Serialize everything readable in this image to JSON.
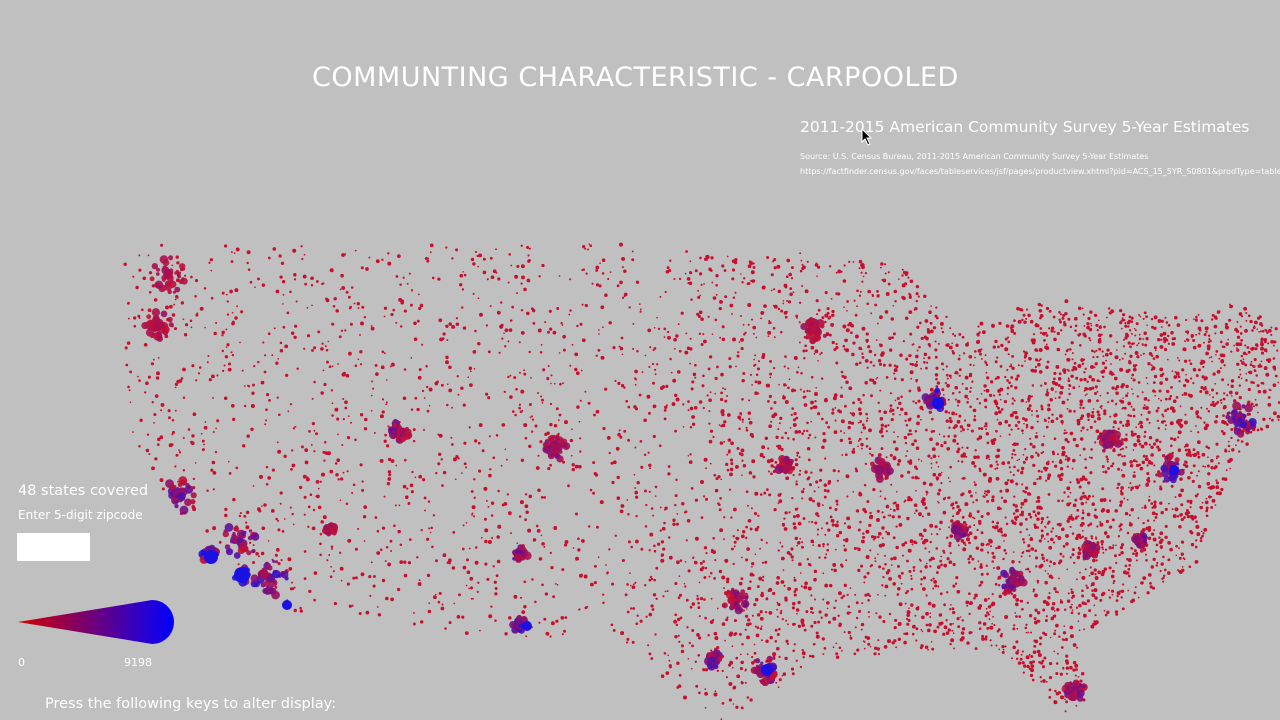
{
  "title": "COMMUNTING CHARACTERISTIC - CARPOOLED",
  "subtitle": "2011-2015 American Community Survey 5-Year Estimates",
  "source": "Source: U.S. Census Bureau, 2011-2015 American Community Survey 5-Year Estimates",
  "url": "https://factfinder.census.gov/faces/tableservices/jsf/pages/productview.xhtml?pid=ACS_15_5YR_S0801&prodType=table",
  "states_covered": "48 states covered",
  "zip_prompt": "Enter 5-digit zipcode",
  "zip_value": "",
  "legend": {
    "min": "0",
    "max": "9198",
    "low_color": "#d40000",
    "high_color": "#0000ff"
  },
  "instructions": "Press the following keys to alter display:",
  "colors": {
    "background": "#c0c0c0",
    "dot_low": "#c8102e",
    "dot_high": "#1a10e6"
  }
}
